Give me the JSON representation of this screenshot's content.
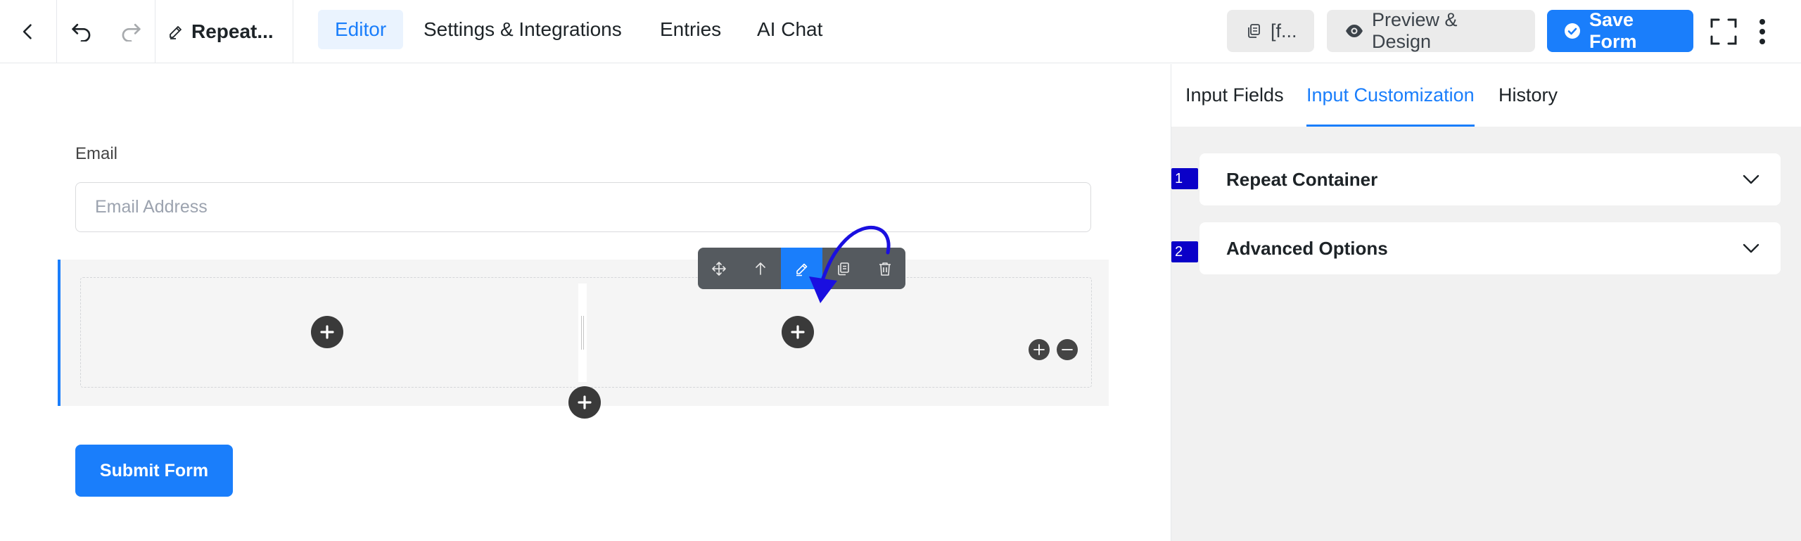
{
  "topbar": {
    "title": "Repeat...",
    "tabs": [
      {
        "label": "Editor",
        "active": true
      },
      {
        "label": "Settings & Integrations",
        "active": false
      },
      {
        "label": "Entries",
        "active": false
      },
      {
        "label": "AI Chat",
        "active": false
      }
    ],
    "shortcode_label": "[f...",
    "preview_label": "Preview & Design",
    "save_label": "Save Form"
  },
  "form": {
    "email_label": "Email",
    "email_placeholder": "Email Address",
    "submit_label": "Submit Form"
  },
  "panel": {
    "tabs": [
      {
        "label": "Input Fields",
        "active": false
      },
      {
        "label": "Input Customization",
        "active": true
      },
      {
        "label": "History",
        "active": false
      }
    ],
    "sections": [
      {
        "badge": "1",
        "label": "Repeat Container"
      },
      {
        "badge": "2",
        "label": "Advanced Options"
      }
    ]
  },
  "colors": {
    "accent": "#1a7efb",
    "annotation": "#1a0fe0",
    "badge": "#0a00c8",
    "dark_button": "#3a3a3a"
  }
}
